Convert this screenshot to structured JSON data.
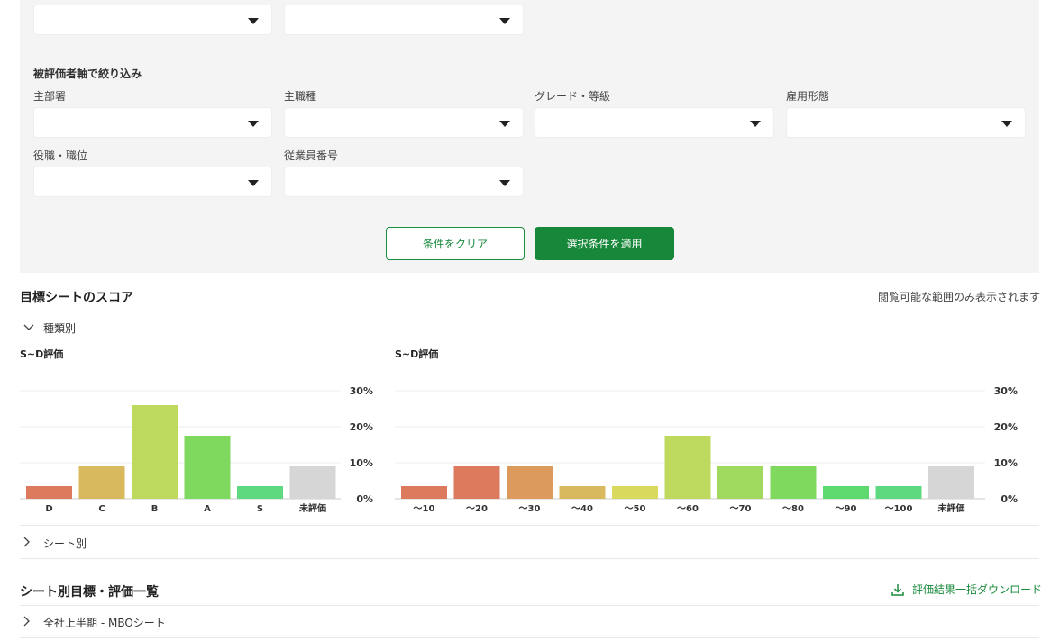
{
  "colors": {
    "accent": "#17873a",
    "panel_bg": "#f4f4f4",
    "grid": "#eeeeee",
    "unrated": "#d6d6d6"
  },
  "filters": {
    "evaluatee_section_label": "被評価者軸で絞り込み",
    "fields": {
      "main_department": "主部署",
      "main_job_type": "主職種",
      "grade": "グレード・等級",
      "employment_type": "雇用形態",
      "position": "役職・職位",
      "employee_number": "従業員番号"
    },
    "clear_button": "条件をクリア",
    "apply_button": "選択条件を適用"
  },
  "score_section": {
    "title": "目標シートのスコア",
    "note": "閲覧可能な範囲のみ表示されます",
    "by_type_toggle": "種類別",
    "by_sheet_toggle": "シート別"
  },
  "chart_data": [
    {
      "type": "bar",
      "title": "S~D評価",
      "categories": [
        "D",
        "C",
        "B",
        "A",
        "S",
        "未評価"
      ],
      "values": [
        3.5,
        9,
        26,
        17.5,
        3.5,
        9
      ],
      "unit": "%",
      "colors": [
        "#dd7a5d",
        "#d9b95e",
        "#bdd95e",
        "#7fd95e",
        "#5ed97f",
        "#d6d6d6"
      ],
      "yticks": [
        "0%",
        "10%",
        "20%",
        "30%"
      ],
      "ylim": [
        0,
        30
      ],
      "grid": true
    },
    {
      "type": "bar",
      "title": "S~D評価",
      "categories": [
        "〜10",
        "〜20",
        "〜30",
        "〜40",
        "〜50",
        "〜60",
        "〜70",
        "〜80",
        "〜90",
        "〜100",
        "未評価"
      ],
      "values": [
        3.5,
        9,
        9,
        3.5,
        3.5,
        17.5,
        9,
        9,
        3.5,
        3.5,
        9
      ],
      "unit": "%",
      "colors": [
        "#dd7a5d",
        "#dd7a5d",
        "#dd9a5d",
        "#d9b95e",
        "#d9d95e",
        "#bdd95e",
        "#9fd95e",
        "#7fd95e",
        "#5ed96e",
        "#5ed97f",
        "#d6d6d6"
      ],
      "yticks": [
        "0%",
        "10%",
        "20%",
        "30%"
      ],
      "ylim": [
        0,
        30
      ],
      "grid": true
    }
  ],
  "sheet_list": {
    "title": "シート別目標・評価一覧",
    "download_label": "評価結果一括ダウンロード",
    "items": [
      {
        "label": "全社上半期 - MBOシート"
      }
    ]
  }
}
